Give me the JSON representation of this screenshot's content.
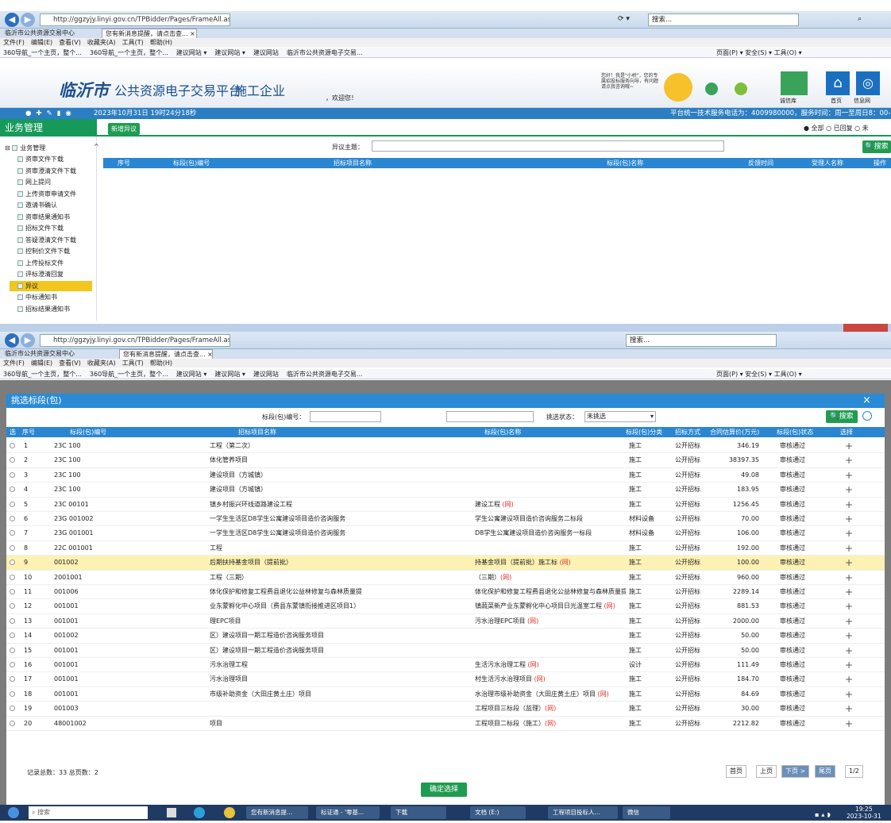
{
  "browser_top": {
    "url": "http://ggzyjy.linyi.gov.cn/TPBidder/Pages/FrameAll.aspx?t=",
    "search_placeholder": "搜索...",
    "tabs": [
      "临沂市公共资源交易中心",
      "您有新消息提醒，请点击查... ×"
    ],
    "menu": [
      "文件(F)",
      "编辑(E)",
      "查看(V)",
      "收藏夹(A)",
      "工具(T)",
      "帮助(H)"
    ],
    "favorites": [
      "360导航_一个主页，整个...",
      "360导航_一个主页，整个...",
      "建议网站 ▾",
      "建议网站 ▾",
      "建议网站",
      "临沂市公共资源电子交易..."
    ],
    "tools_right": "页面(P) ▾  安全(S) ▾  工具(O) ▾"
  },
  "banner": {
    "city": "临沂市",
    "platform": "公共资源电子交易平台",
    "role": "施工企业",
    "welcome": "，欢迎您！",
    "assistant": "您好！我是\"小桥\"，您的专属招投标服务向导，有问题请点我咨询哦~",
    "icons": [
      "诚信库",
      "首页",
      "信息网"
    ]
  },
  "status": {
    "datetime": "2023年10月31日 19时24分18秒",
    "hotline": "平台统一技术服务电话为：4009980000，服务时间：周一至周日8：00-17"
  },
  "module": {
    "title": "业务管理",
    "tab": "新增异议",
    "filter": [
      "● 全部",
      "○ 已回复",
      "○ 未"
    ],
    "subject_label": "异议主题：",
    "search_btn": "搜索",
    "tree_root": "业务管理",
    "tree": [
      "资审文件下载",
      "资审澄清文件下载",
      "网上提问",
      "上传资审申请文件",
      "邀请书确认",
      "资审结果通知书",
      "招标文件下载",
      "答疑澄清文件下载",
      "控制价文件下载",
      "上传投标文件",
      "评标澄清回复",
      "异议",
      "中标通知书",
      "招标结果通知书"
    ],
    "tree_active": "异议",
    "columns": [
      "序号",
      "标段(包)编号",
      "招标项目名称",
      "标段(包)名称",
      "反馈时间",
      "受理人名称",
      "操作"
    ]
  },
  "browser_bottom": {
    "url": "http://ggzyjy.linyi.gov.cn/TPBidder/Pages/FrameAll.aspx?t=",
    "tabs": [
      "临沂市公共资源交易中心",
      "您有新消息提醒，请点击查... ×"
    ],
    "menu": [
      "文件(F)",
      "编辑(E)",
      "查看(V)",
      "收藏夹(A)",
      "工具(T)",
      "帮助(H)"
    ],
    "favorites": [
      "360导航_一个主页，整个...",
      "360导航_一个主页，整个...",
      "建议网站 ▾",
      "建议网站 ▾",
      "建议网站",
      "临沂市公共资源电子交易..."
    ],
    "tools_right": "页面(P) ▾  安全(S) ▾  工具(O) ▾"
  },
  "dialog": {
    "title": "挑选标段(包)",
    "close": "×",
    "code_label": "标段(包)编号：",
    "status_label": "挑选状态：",
    "status_value": "未挑选",
    "search_btn": "搜索",
    "columns": [
      "选",
      "序号",
      "标段(包)编号",
      "招标项目名称",
      "标段(包)名称",
      "标段(包)分类",
      "招标方式",
      "合同估算价(万元)",
      "标段(包)状态",
      "选择"
    ],
    "rows": [
      {
        "no": "1",
        "code": "23C  100",
        "proj": "工程（第二次）",
        "name": "",
        "cat": "施工",
        "method": "公开招标",
        "price": "346.19",
        "state": "审核通过"
      },
      {
        "no": "2",
        "code": "23C  100",
        "proj": "体化管养项目",
        "name": "",
        "cat": "施工",
        "method": "公开招标",
        "price": "38397.35",
        "state": "审核通过"
      },
      {
        "no": "3",
        "code": "23C  100",
        "proj": "建设项目（方城镇）",
        "name": "",
        "cat": "施工",
        "method": "公开招标",
        "price": "49.08",
        "state": "审核通过"
      },
      {
        "no": "4",
        "code": "23C  100",
        "proj": "建设项目（方城镇）",
        "name": "",
        "cat": "施工",
        "method": "公开招标",
        "price": "183.95",
        "state": "审核通过"
      },
      {
        "no": "5",
        "code": "23C  00101",
        "proj": "镇乡村振兴环线道路建设工程",
        "name": "建设工程 (网)",
        "cat": "施工",
        "method": "公开招标",
        "price": "1256.45",
        "state": "审核通过"
      },
      {
        "no": "6",
        "code": "23G  001002",
        "proj": "一学生生活区D8学生公寓建设项目造价咨询服务",
        "name": "学生公寓建设项目造价咨询服务二标段",
        "cat": "材料设备",
        "method": "公开招标",
        "price": "70.00",
        "state": "审核通过"
      },
      {
        "no": "7",
        "code": "23G  001001",
        "proj": "一学生生活区D8学生公寓建设项目造价咨询服务",
        "name": "D8学生公寓建设项目造价咨询服务一标段",
        "cat": "材料设备",
        "method": "公开招标",
        "price": "106.00",
        "state": "审核通过"
      },
      {
        "no": "8",
        "code": "22C  001001",
        "proj": "工程",
        "name": "",
        "cat": "施工",
        "method": "公开招标",
        "price": "192.00",
        "state": "审核通过"
      },
      {
        "no": "9",
        "code": "001002",
        "proj": "后期扶持基金项目（提前批）",
        "name": "持基金项目（提前批）施工标 (网)",
        "cat": "施工",
        "method": "公开招标",
        "price": "100.00",
        "state": "审核通过"
      },
      {
        "no": "10",
        "code": "2001001",
        "proj": "工程（三期）",
        "name": "（三期）(网)",
        "cat": "施工",
        "method": "公开招标",
        "price": "960.00",
        "state": "审核通过"
      },
      {
        "no": "11",
        "code": "001006",
        "proj": "体化保护和修复工程费县退化公益林修复与森林质量提",
        "name": "体化保护和修复工程费县退化公益林修复与森林质量提",
        "cat": "施工",
        "method": "公开招标",
        "price": "2289.14",
        "state": "审核通过"
      },
      {
        "no": "12",
        "code": "001001",
        "proj": "业东蒙孵化中心项目（费县东蒙镇衔接推进区项目1）",
        "name": "镇蔬菜新产业东蒙孵化中心项目日光温室工程 (网)",
        "cat": "施工",
        "method": "公开招标",
        "price": "881.53",
        "state": "审核通过"
      },
      {
        "no": "13",
        "code": "001001",
        "proj": "理EPC项目",
        "name": "污水治理EPC项目 (网)",
        "cat": "施工",
        "method": "公开招标",
        "price": "2000.00",
        "state": "审核通过"
      },
      {
        "no": "14",
        "code": "001002",
        "proj": "区）建设项目一期工程造价咨询服务项目",
        "name": "",
        "cat": "施工",
        "method": "公开招标",
        "price": "50.00",
        "state": "审核通过"
      },
      {
        "no": "15",
        "code": "001001",
        "proj": "区）建设项目一期工程造价咨询服务项目",
        "name": "",
        "cat": "施工",
        "method": "公开招标",
        "price": "50.00",
        "state": "审核通过"
      },
      {
        "no": "16",
        "code": "001001",
        "proj": "污水治理工程",
        "name": "生活污水治理工程 (网)",
        "cat": "设计",
        "method": "公开招标",
        "price": "111.49",
        "state": "审核通过"
      },
      {
        "no": "17",
        "code": "001001",
        "proj": "污水治理项目",
        "name": "村生活污水治理项目 (网)",
        "cat": "施工",
        "method": "公开招标",
        "price": "184.70",
        "state": "审核通过"
      },
      {
        "no": "18",
        "code": "001001",
        "proj": "市级补助资金（大田庄黄土庄）项目",
        "name": "水治理市级补助资金（大田庄黄土庄）项目 (网)",
        "cat": "施工",
        "method": "公开招标",
        "price": "84.69",
        "state": "审核通过"
      },
      {
        "no": "19",
        "code": "001003",
        "proj": "",
        "name": "工程项目三标段（监理）(网)",
        "cat": "施工",
        "method": "公开招标",
        "price": "30.00",
        "state": "审核通过"
      },
      {
        "no": "20",
        "code": "48001002",
        "proj": "项目",
        "name": "工程项目二标段（施工）(网)",
        "cat": "施工",
        "method": "公开招标",
        "price": "2212.82",
        "state": "审核通过"
      }
    ],
    "highlight_row": "9",
    "footer_total": "记录总数：33  总页数：2",
    "pager": [
      "首页",
      "上页",
      "下页 >",
      "尾页"
    ],
    "page_value": "1/2",
    "confirm": "确定选择"
  },
  "taskbar": {
    "search": "搜索",
    "items": [
      "您有新消息提...",
      "标证通 - '零基...",
      "下载",
      "文档 (E:)",
      "工程项目投标人...",
      "微信"
    ],
    "time": "19:25",
    "date": "2023-10-31"
  },
  "colors": {
    "header_blue": "#2a86d1",
    "green": "#17995a",
    "highlight": "#fdf2b3",
    "link_red": "#e0302a"
  }
}
